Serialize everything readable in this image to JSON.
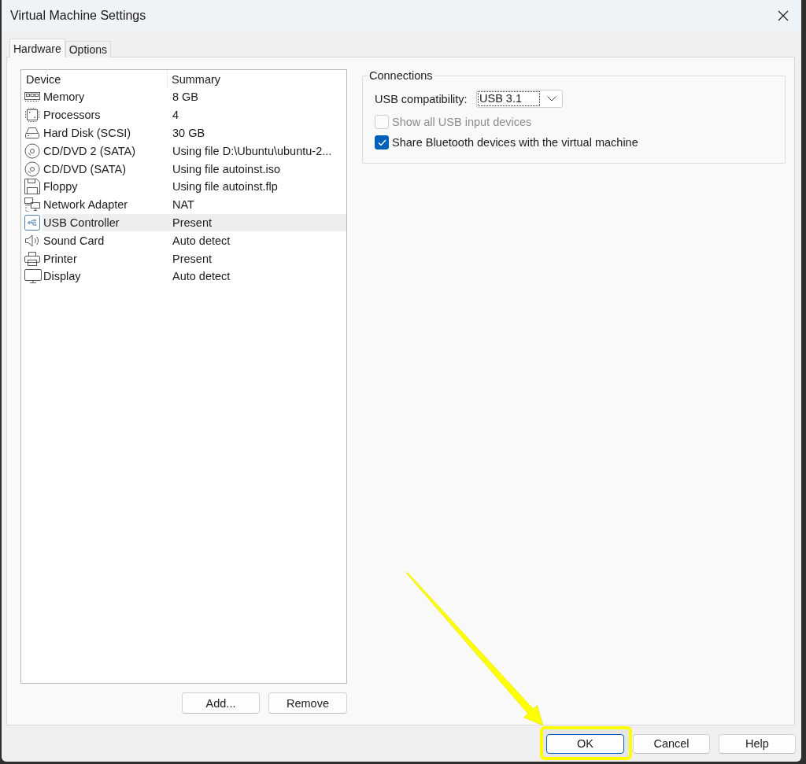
{
  "window": {
    "title": "Virtual Machine Settings"
  },
  "tabs": [
    {
      "label": "Hardware",
      "selected": true
    },
    {
      "label": "Options",
      "selected": false
    }
  ],
  "device_table": {
    "columns": [
      "Device",
      "Summary"
    ],
    "rows": [
      {
        "kind": "memory",
        "device": "Memory",
        "summary": "8 GB",
        "selected": false
      },
      {
        "kind": "processor",
        "device": "Processors",
        "summary": "4",
        "selected": false
      },
      {
        "kind": "disk",
        "device": "Hard Disk (SCSI)",
        "summary": "30 GB",
        "selected": false
      },
      {
        "kind": "cd",
        "device": "CD/DVD 2 (SATA)",
        "summary": "Using file D:\\Ubuntu\\ubuntu-2...",
        "selected": false
      },
      {
        "kind": "cd",
        "device": "CD/DVD (SATA)",
        "summary": "Using file autoinst.iso",
        "selected": false
      },
      {
        "kind": "floppy",
        "device": "Floppy",
        "summary": "Using file autoinst.flp",
        "selected": false
      },
      {
        "kind": "network",
        "device": "Network Adapter",
        "summary": "NAT",
        "selected": false
      },
      {
        "kind": "usb",
        "device": "USB Controller",
        "summary": "Present",
        "selected": true
      },
      {
        "kind": "sound",
        "device": "Sound Card",
        "summary": "Auto detect",
        "selected": false
      },
      {
        "kind": "printer",
        "device": "Printer",
        "summary": "Present",
        "selected": false
      },
      {
        "kind": "display",
        "device": "Display",
        "summary": "Auto detect",
        "selected": false
      }
    ]
  },
  "device_buttons": [
    "Add...",
    "Remove"
  ],
  "connections": {
    "title": "Connections",
    "usb_compatibility": {
      "label": "USB compatibility:",
      "value": "USB 3.1"
    },
    "checkboxes": [
      {
        "label": "Show all USB input devices",
        "checked": false,
        "disabled": true
      },
      {
        "label": "Share Bluetooth devices with the virtual machine",
        "checked": true,
        "disabled": false
      }
    ]
  },
  "dialog_buttons": [
    {
      "label": "OK",
      "default": true,
      "highlighted": true
    },
    {
      "label": "Cancel",
      "default": false,
      "highlighted": false
    },
    {
      "label": "Help",
      "default": false,
      "highlighted": false
    }
  ]
}
